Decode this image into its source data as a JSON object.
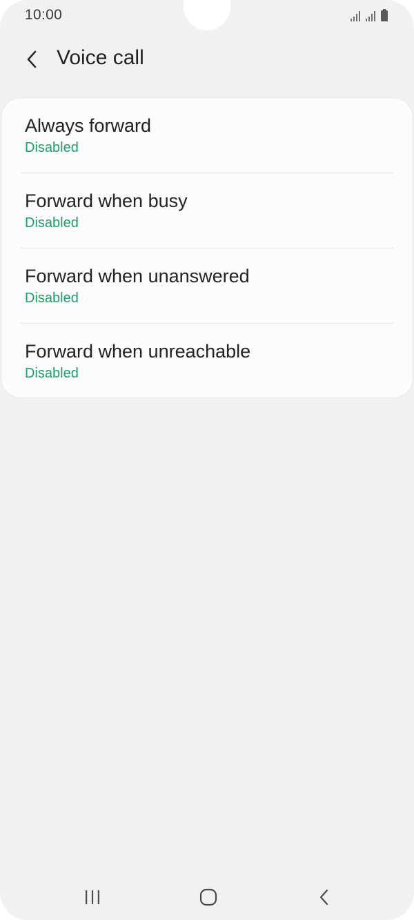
{
  "status_bar": {
    "time": "10:00",
    "icons": [
      "signal-icon",
      "signal-icon",
      "battery-icon"
    ]
  },
  "header": {
    "back_icon": "chevron-left-icon",
    "title": "Voice call"
  },
  "forwarding_options": [
    {
      "title": "Always forward",
      "status": "Disabled"
    },
    {
      "title": "Forward when busy",
      "status": "Disabled"
    },
    {
      "title": "Forward when unanswered",
      "status": "Disabled"
    },
    {
      "title": "Forward when unreachable",
      "status": "Disabled"
    }
  ],
  "navigation_bar": {
    "icons": [
      "recents-icon",
      "home-icon",
      "back-icon"
    ]
  },
  "colors": {
    "background": "#f1f1f1",
    "card": "#fcfcfc",
    "status_text": "#1a9e6a",
    "primary_text": "#222222"
  }
}
